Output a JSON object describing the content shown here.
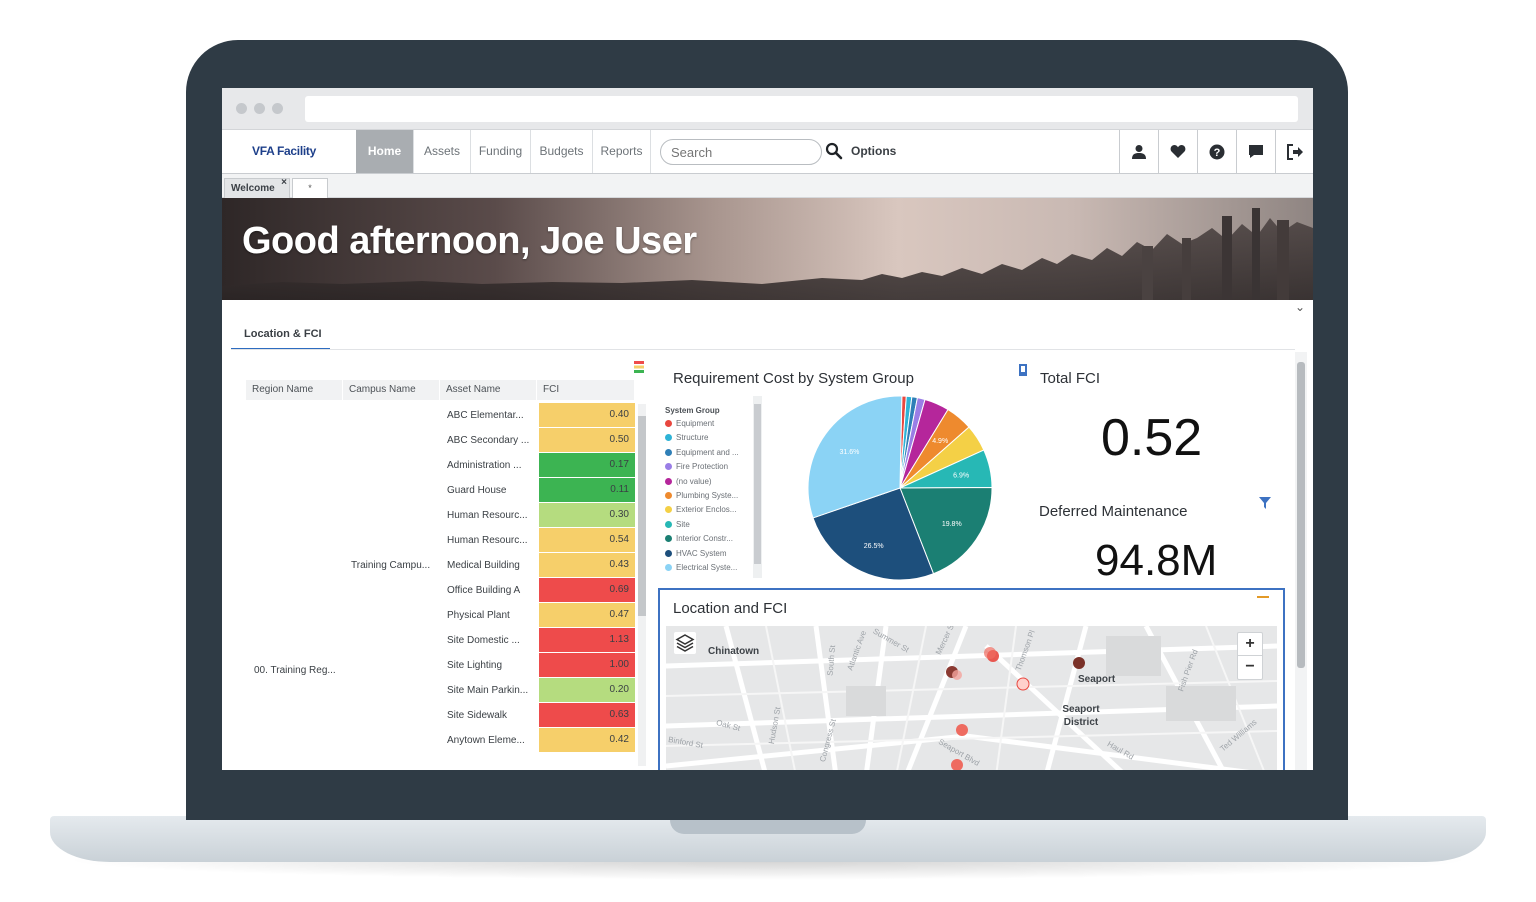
{
  "app": {
    "logo": "VFA Facility",
    "nav_tabs": [
      {
        "label": "Home",
        "active": true
      },
      {
        "label": "Assets",
        "active": false
      },
      {
        "label": "Funding",
        "active": false
      },
      {
        "label": "Budgets",
        "active": false
      },
      {
        "label": "Reports",
        "active": false
      }
    ],
    "search_placeholder": "Search",
    "options_label": "Options",
    "nav_icons": [
      "user-icon",
      "heart-icon",
      "help-icon",
      "chat-icon",
      "logout-icon"
    ]
  },
  "tabs": {
    "welcome_label": "Welcome",
    "close_glyph": "×",
    "add_glyph": "*"
  },
  "banner": {
    "greeting": "Good afternoon, Joe User",
    "collapse_glyph": "⌄"
  },
  "section": {
    "tab_label": "Location & FCI"
  },
  "table": {
    "headers": [
      "Region Name",
      "Campus Name",
      "Asset Name",
      "FCI"
    ],
    "region_value": "00. Training Reg...",
    "campus_value": "Training Campu...",
    "rows": [
      {
        "asset": "ABC Elementar...",
        "fci": "0.40",
        "color": "#f6cf6a"
      },
      {
        "asset": "ABC Secondary ...",
        "fci": "0.50",
        "color": "#f6cf6a"
      },
      {
        "asset": "Administration ...",
        "fci": "0.17",
        "color": "#3cb452"
      },
      {
        "asset": "Guard House",
        "fci": "0.11",
        "color": "#3cb452"
      },
      {
        "asset": "Human Resourc...",
        "fci": "0.30",
        "color": "#b5dc7f"
      },
      {
        "asset": "Human Resourc...",
        "fci": "0.54",
        "color": "#f6cf6a"
      },
      {
        "asset": "Medical Building",
        "fci": "0.43",
        "color": "#f6cf6a"
      },
      {
        "asset": "Office Building A",
        "fci": "0.69",
        "color": "#ee4b4b"
      },
      {
        "asset": "Physical Plant",
        "fci": "0.47",
        "color": "#f6cf6a"
      },
      {
        "asset": "Site Domestic ...",
        "fci": "1.13",
        "color": "#ee4b4b"
      },
      {
        "asset": "Site Lighting",
        "fci": "1.00",
        "color": "#ee4b4b"
      },
      {
        "asset": "Site Main Parkin...",
        "fci": "0.20",
        "color": "#b5dc7f"
      },
      {
        "asset": "Site Sidewalk",
        "fci": "0.63",
        "color": "#ee4b4b"
      },
      {
        "asset": "Anytown Eleme...",
        "fci": "0.42",
        "color": "#f6cf6a"
      }
    ]
  },
  "pie_panel": {
    "title": "Requirement Cost by System Group",
    "legend_header": "System Group",
    "legend": [
      {
        "label": "Equipment",
        "color": "#e8473f"
      },
      {
        "label": "Structure",
        "color": "#2eb3d6"
      },
      {
        "label": "Equipment and ...",
        "color": "#2f7fb7"
      },
      {
        "label": "Fire Protection",
        "color": "#9a7ee6"
      },
      {
        "label": "(no value)",
        "color": "#b5269b"
      },
      {
        "label": "Plumbing Syste...",
        "color": "#ee8a2e"
      },
      {
        "label": "Exterior Enclos...",
        "color": "#f4d046"
      },
      {
        "label": "Site",
        "color": "#27b8b5"
      },
      {
        "label": "Interior Constr...",
        "color": "#1b7f73"
      },
      {
        "label": "HVAC System",
        "color": "#1d4f7c"
      },
      {
        "label": "Electrical Syste...",
        "color": "#8bd3f5"
      }
    ]
  },
  "chart_data": {
    "type": "pie",
    "title": "Requirement Cost by System Group",
    "legend_title": "System Group",
    "slice_labels": [
      "",
      "",
      "",
      "",
      "",
      "4.9%",
      "",
      "6.9%",
      "19.8%",
      "26.5%",
      "31.6%"
    ],
    "categories": [
      "Equipment",
      "Structure",
      "Equipment and ...",
      "Fire Protection",
      "(no value)",
      "Plumbing Syste...",
      "Exterior Enclos...",
      "Site",
      "Interior Constr...",
      "HVAC System",
      "Electrical Syste..."
    ],
    "values": [
      0.8,
      1.0,
      1.0,
      1.4,
      4.5,
      4.9,
      4.9,
      6.9,
      19.8,
      26.5,
      31.6
    ],
    "colors": [
      "#e8473f",
      "#2eb3d6",
      "#2f7fb7",
      "#9a7ee6",
      "#b5269b",
      "#ee8a2e",
      "#f4d046",
      "#27b8b5",
      "#1b7f73",
      "#1d4f7c",
      "#8bd3f5"
    ]
  },
  "kpi": {
    "fci_label": "Total FCI",
    "fci_value": "0.52",
    "dm_label": "Deferred Maintenance",
    "dm_value": "94.8M"
  },
  "map_panel": {
    "title": "Location and FCI",
    "zoom_in": "+",
    "zoom_out": "−",
    "labels": [
      "Chinatown",
      "Seaport",
      "Seaport District"
    ],
    "streets": [
      "Summer St",
      "Atlantic Ave",
      "South St",
      "Hudson St",
      "Oak St",
      "Congress St",
      "Thomson Pl",
      "Fish Pier Rd",
      "Seaport Blvd",
      "Ted Williams",
      "Haul Rd",
      "Binford St",
      "Mercer St"
    ]
  }
}
